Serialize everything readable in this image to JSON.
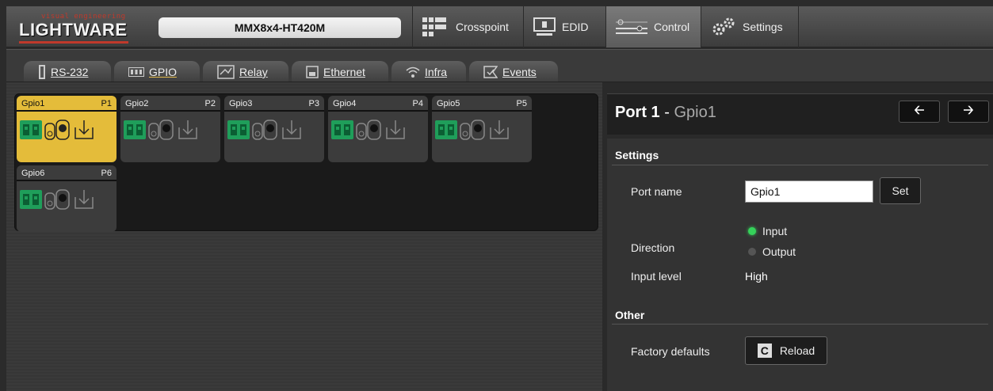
{
  "logo": {
    "tagline": "visual engineering",
    "brand": "LIGHTWARE"
  },
  "device": {
    "name": "MMX8x4-HT420M"
  },
  "nav": [
    {
      "label": "Crosspoint",
      "icon": "grid-icon"
    },
    {
      "label": "EDID",
      "icon": "monitor-icon"
    },
    {
      "label": "Control",
      "icon": "control-icon",
      "active": true
    },
    {
      "label": "Settings",
      "icon": "gears-icon"
    }
  ],
  "subtabs": [
    {
      "label": "RS-232",
      "icon": "serial-icon"
    },
    {
      "label": "GPIO",
      "icon": "gpio-icon",
      "active": true
    },
    {
      "label": "Relay",
      "icon": "relay-icon"
    },
    {
      "label": "Ethernet",
      "icon": "ethernet-icon"
    },
    {
      "label": "Infra",
      "icon": "infra-icon"
    },
    {
      "label": "Events",
      "icon": "events-icon"
    }
  ],
  "ports": [
    {
      "name": "Gpio1",
      "num": "P1",
      "active": true
    },
    {
      "name": "Gpio2",
      "num": "P2"
    },
    {
      "name": "Gpio3",
      "num": "P3"
    },
    {
      "name": "Gpio4",
      "num": "P4"
    },
    {
      "name": "Gpio5",
      "num": "P5"
    },
    {
      "name": "Gpio6",
      "num": "P6"
    }
  ],
  "detail": {
    "port_label": "Port 1",
    "separator": " - ",
    "port_name": "Gpio1",
    "prev_icon": "arrow-left-icon",
    "next_icon": "arrow-right-icon",
    "settings_title": "Settings",
    "port_name_label": "Port name",
    "port_name_value": "Gpio1",
    "set_label": "Set",
    "direction_label": "Direction",
    "direction_input": "Input",
    "direction_output": "Output",
    "direction_selected": "Input",
    "input_level_label": "Input level",
    "input_level_value": "High",
    "other_title": "Other",
    "factory_label": "Factory defaults",
    "reload_label": "Reload",
    "reload_icon_glyph": "C"
  },
  "colors": {
    "accent": "#e4bc3a",
    "connector_green": "#1f9e5a",
    "radio_on": "#35d25a",
    "logo_red": "#c0392b"
  }
}
